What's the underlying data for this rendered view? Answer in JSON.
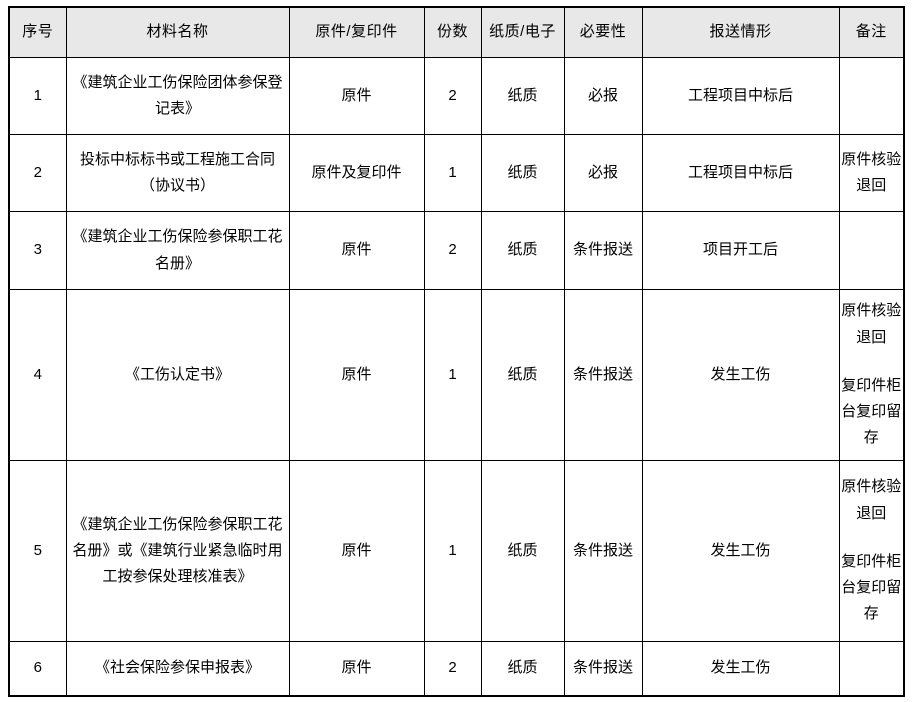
{
  "table": {
    "name": "materials-submission-table",
    "columns": [
      {
        "key": "seq",
        "label": "序号"
      },
      {
        "key": "name",
        "label": "材料名称"
      },
      {
        "key": "copy",
        "label": "原件/复印件"
      },
      {
        "key": "count",
        "label": "份数"
      },
      {
        "key": "media",
        "label": "纸质/电子"
      },
      {
        "key": "need",
        "label": "必要性"
      },
      {
        "key": "when",
        "label": "报送情形"
      },
      {
        "key": "remark",
        "label": "备注"
      }
    ],
    "rows": [
      {
        "seq": "1",
        "name": "《建筑企业工伤保险团体参保登记表》",
        "copy": "原件",
        "count": "2",
        "media": "纸质",
        "need": "必报",
        "when": "工程项目中标后",
        "remark_1": "",
        "remark_2": ""
      },
      {
        "seq": "2",
        "name": "投标中标标书或工程施工合同（协议书）",
        "copy": "原件及复印件",
        "count": "1",
        "media": "纸质",
        "need": "必报",
        "when": "工程项目中标后",
        "remark_1": "原件核验退回",
        "remark_2": ""
      },
      {
        "seq": "3",
        "name": "《建筑企业工伤保险参保职工花名册》",
        "copy": "原件",
        "count": "2",
        "media": "纸质",
        "need": "条件报送",
        "when": "项目开工后",
        "remark_1": "",
        "remark_2": ""
      },
      {
        "seq": "4",
        "name": "《工伤认定书》",
        "copy": "原件",
        "count": "1",
        "media": "纸质",
        "need": "条件报送",
        "when": "发生工伤",
        "remark_1": "原件核验退回",
        "remark_2": "复印件柜台复印留存"
      },
      {
        "seq": "5",
        "name": "《建筑企业工伤保险参保职工花名册》或《建筑行业紧急临时用工按参保处理核准表》",
        "copy": "原件",
        "count": "1",
        "media": "纸质",
        "need": "条件报送",
        "when": "发生工伤",
        "remark_1": "原件核验退回",
        "remark_2": "复印件柜台复印留存"
      },
      {
        "seq": "6",
        "name": "《社会保险参保申报表》",
        "copy": "原件",
        "count": "2",
        "media": "纸质",
        "need": "条件报送",
        "when": "发生工伤",
        "remark_1": "",
        "remark_2": ""
      }
    ]
  },
  "colors": {
    "header_background": "#e8e8e8",
    "border": "#000000",
    "text": "#000000",
    "page_background": "#ffffff"
  }
}
